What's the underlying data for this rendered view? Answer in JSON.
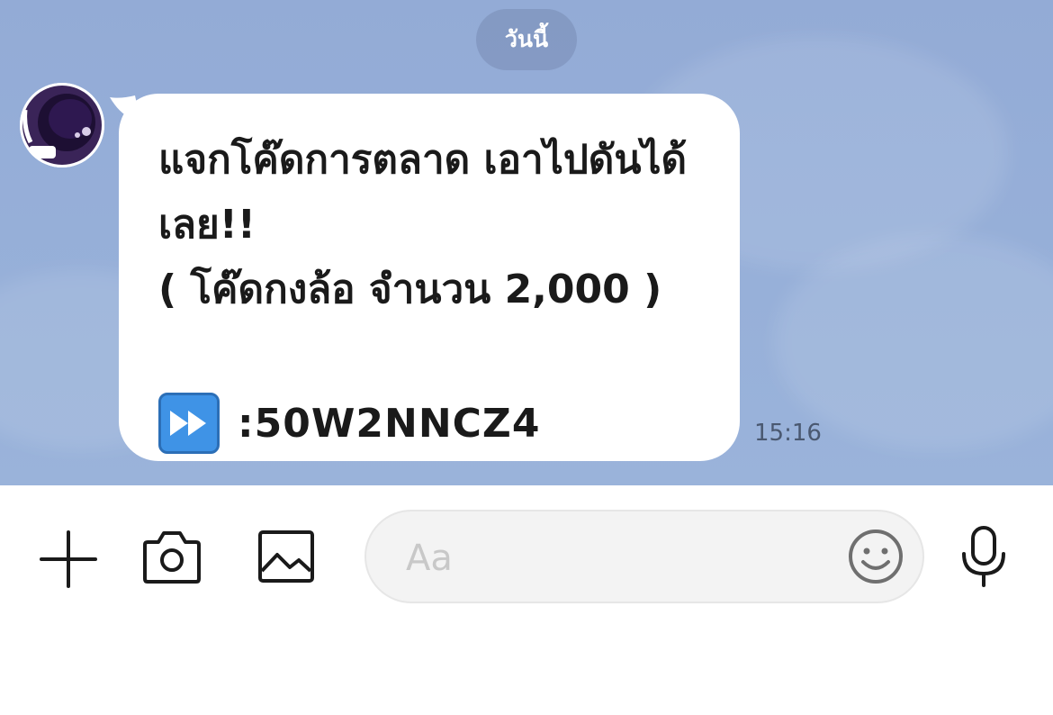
{
  "chat": {
    "date_divider": "วันนี้",
    "message": {
      "lines": [
        "แจกโค๊ดการตลาด เอาไปดันได้",
        "เลย!!",
        "( โค๊ดกงล้อ จำนวน 2,000 )"
      ],
      "code_prefix": ": ",
      "code": "50W2NNCZ4",
      "emoji": "fast-forward-button",
      "time": "15:16"
    },
    "avatar_icon": "astronaut-avatar"
  },
  "input_bar": {
    "placeholder": "Aa",
    "icons": [
      "plus-icon",
      "camera-icon",
      "image-icon",
      "emoji-icon",
      "microphone-icon"
    ]
  },
  "colors": {
    "chat_background": "#95aed8",
    "bubble": "#ffffff",
    "date_pill": "#7f95bd",
    "emoji_blue": "#3f93e6"
  }
}
